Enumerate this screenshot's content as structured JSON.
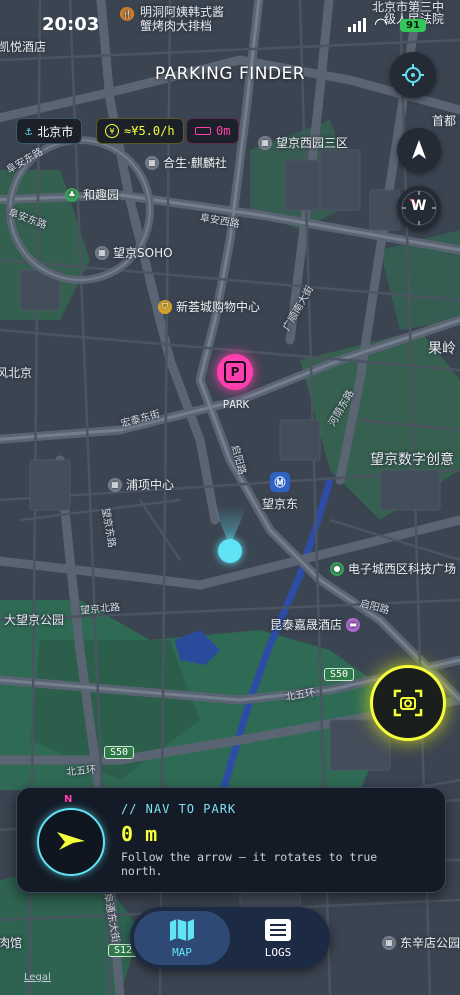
{
  "status": {
    "time": "20:03",
    "battery": "91"
  },
  "app": {
    "title": "PARKING FINDER"
  },
  "chips": {
    "city": "北京市",
    "rate": "≈¥5.0/h",
    "distance": "0m"
  },
  "map": {
    "labels": {
      "top_restaurant_1": "明洞阿姨韩式酱",
      "top_restaurant_2": "蟹烤肉大排档",
      "court_1": "北京市第三中",
      "court_2": "级人民法院",
      "hotel_left": "凯悦酒店",
      "shouzhuo": "首都",
      "wangjing_west_3": "望京西园三区",
      "hesheng": "合生·麒麟社",
      "hequ": "和趣园",
      "wangjing_soho": "望京SOHO",
      "xinhui": "新荟城购物中心",
      "guoling": "果岭",
      "fenglin": "风北京",
      "wangjing_digital": "望京数字创意",
      "puxiang": "浦项中心",
      "wangjing_east": "望京东",
      "dianzi": "电子城西区科技广场",
      "dawangjing": "大望京公园",
      "kuntai": "昆泰嘉晟酒店",
      "dongxindian": "东辛店公园",
      "meat": "肉馆",
      "road_fuantong": "阜安东路",
      "road_fuandong2": "阜安东路",
      "road_fuanxi": "阜安西路",
      "road_guangshun": "广顺南大街",
      "road_futong": "阜通东大街",
      "road_wangjing": "望京东街",
      "road_hongtai": "宏泰东街",
      "road_qiyang": "启阳路",
      "road_wangjingbei": "望京北路",
      "road_wangjingdong": "望京东路",
      "road_beiwuhuan": "北五环",
      "road_beiwuhuan2": "北五环",
      "road_s50": "S50",
      "road_s50b": "S50",
      "road_s12": "S12",
      "road_qiyang2": "启阳路",
      "road_hexi": "河荫东路",
      "legal": "Legal"
    },
    "park_marker": "PARK"
  },
  "nav_card": {
    "compass_n": "N",
    "eyebrow": "// NAV TO PARK",
    "distance": "0 m",
    "hint": "Follow the arrow — it rotates to true north."
  },
  "compass_button": {
    "w": "W"
  },
  "tabs": [
    {
      "label": "MAP",
      "icon": "map-icon",
      "active": true
    },
    {
      "label": "LOGS",
      "icon": "list-icon",
      "active": false
    }
  ],
  "colors": {
    "accent_cyan": "#5fe3f5",
    "accent_yellow": "#f6ff3c",
    "accent_pink": "#ff3fae"
  }
}
